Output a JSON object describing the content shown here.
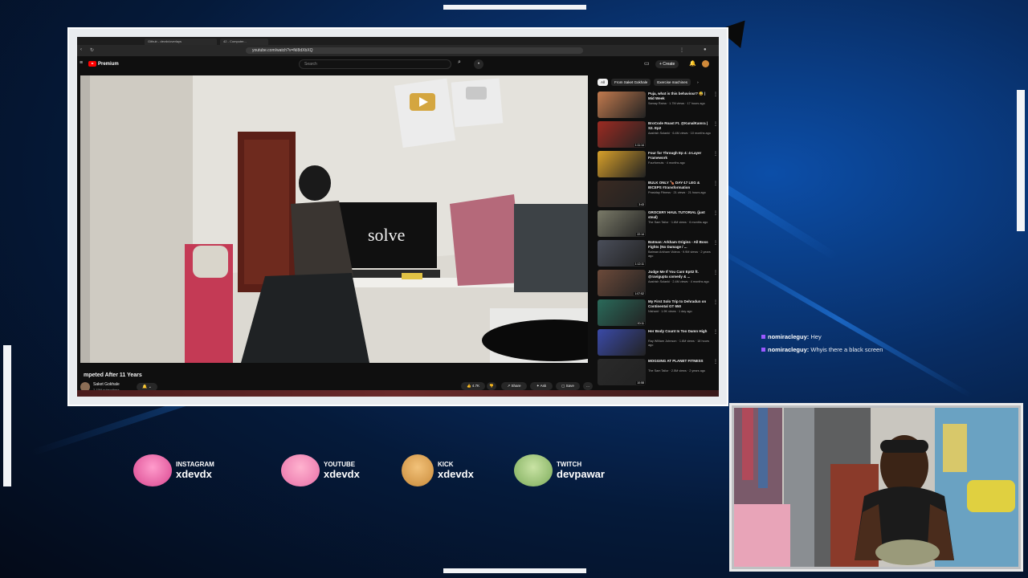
{
  "browser": {
    "tabs": [
      "Github - devdx/overlays",
      "42 - Computer..."
    ],
    "url": "youtube.com/watch?v=fkI8dXbXQ"
  },
  "youtube": {
    "logo_text": "Premium",
    "search_placeholder": "Search",
    "create_label": "+ Create",
    "video_title": "mpeted After 11 Years",
    "video_overlay_word": "solve",
    "channel_name": "Saket Gokhale",
    "channel_subs": "2.15M subscribers",
    "actions": {
      "like": "4.7K",
      "share": "Share",
      "ask": "Ask",
      "save": "Save",
      "more": "…"
    },
    "chips": [
      "All",
      "From Saket Gokhale",
      "Exercise machines"
    ],
    "recommendations": [
      {
        "title": "Puja, what is this behaviour? 😅 | Mid Week",
        "meta": "Samay Raina · 1.7M views · 17 hours ago",
        "duration": "",
        "color": "#c27a4e"
      },
      {
        "title": "BroCode Roast Ft. @KunalKamra | S2. Ep2",
        "meta": "Aashish Solanki · 6.4M views · 10 months ago",
        "duration": "1:11:14",
        "color": "#9c2b22"
      },
      {
        "title": "Four for Through Ep 4: 4-Layer Framework",
        "meta": "Fourfornuts · 4 months ago",
        "duration": "",
        "color": "#d8a02a"
      },
      {
        "title": "BULK ONLY 🍗 DAY-17 LEG & BICEPS #transformation",
        "meta": "Prasiday Fitness · 21 views · 21 hours ago",
        "duration": "3:43",
        "color": "#3a2a22"
      },
      {
        "title": "GROCERY HAUL TUTORIAL (just steal)",
        "meta": "The Sam Tailor · 1.6M views · 6 months ago",
        "duration": "22:14",
        "color": "#7a7a68"
      },
      {
        "title": "Batman: Arkham Origins - All Boss Fights (No Damage / ...",
        "meta": "Batman Arkham Videos · 9.9M views · 2 years ago",
        "duration": "1:12:11",
        "color": "#4a4e5a"
      },
      {
        "title": "Judge Me If You Can! Ep02 ft. @ravigupta comedy & ...",
        "meta": "Aashish Solanki · 2.4M views · 4 months ago",
        "duration": "1:07:52",
        "color": "#6c4a3a"
      },
      {
        "title": "My First Solo Trip to Dehradun on Continental GT 650",
        "meta": "Nishant · 1.9K views · 1 day ago",
        "duration": "20:11",
        "color": "#2a6a5a"
      },
      {
        "title": "Her Body Count Is Too Damn High",
        "meta": "Ray William Johnson · 1.6M views · 18 hours ago",
        "duration": "",
        "color": "#3a4aa8"
      },
      {
        "title": "MOGGING AT PLANET FITNESS",
        "meta": "The Sam Tailor · 2.5M views · 2 years ago",
        "duration": "10:58",
        "color": "#2a2a2a"
      }
    ]
  },
  "chat": [
    {
      "user": "nomiracleguy:",
      "message": "Hey"
    },
    {
      "user": "nomiracleguy:",
      "message": "Whyis there a black screen"
    }
  ],
  "socials": [
    {
      "label": "INSTAGRAM",
      "handle": "xdevdx",
      "color": "#d9468f"
    },
    {
      "label": "YOUTUBE",
      "handle": "xdevdx",
      "color": "#e86fa8"
    },
    {
      "label": "KICK",
      "handle": "xdevdx",
      "color": "#c98a3a"
    },
    {
      "label": "TWITCH",
      "handle": "devpawar",
      "color": "#7cab5a"
    }
  ],
  "colors": {
    "accent_blue": "#0c4ea8",
    "youtube_red": "#ff0000",
    "chat_pip": "#9b59ff"
  }
}
